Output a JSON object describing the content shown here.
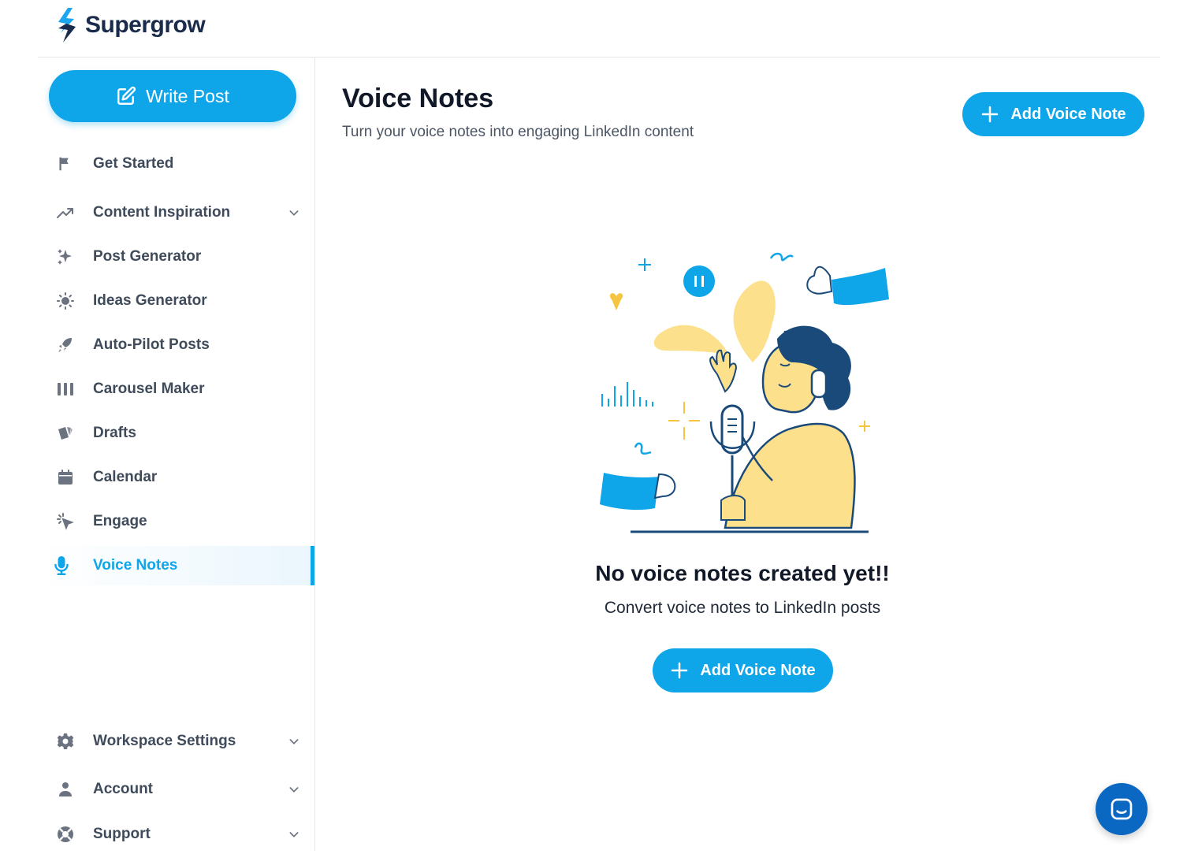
{
  "app": {
    "name": "Supergrow"
  },
  "sidebar": {
    "write_post_label": "Write Post",
    "items": [
      {
        "label": "Get Started",
        "icon": "flag-icon"
      },
      {
        "label": "Content Inspiration",
        "icon": "trending-up-icon",
        "expandable": true
      },
      {
        "label": "Post Generator",
        "icon": "sparkles-icon"
      },
      {
        "label": "Ideas Generator",
        "icon": "lightbulb-icon"
      },
      {
        "label": "Auto-Pilot Posts",
        "icon": "rocket-icon"
      },
      {
        "label": "Carousel Maker",
        "icon": "columns-icon"
      },
      {
        "label": "Drafts",
        "icon": "cards-icon"
      },
      {
        "label": "Calendar",
        "icon": "calendar-icon"
      },
      {
        "label": "Engage",
        "icon": "cursor-click-icon"
      },
      {
        "label": "Voice Notes",
        "icon": "microphone-icon",
        "active": true
      }
    ],
    "bottom_items": [
      {
        "label": "Workspace Settings",
        "icon": "gear-icon",
        "expandable": true
      },
      {
        "label": "Account",
        "icon": "user-icon",
        "expandable": true
      },
      {
        "label": "Support",
        "icon": "lifebuoy-icon",
        "expandable": true
      }
    ]
  },
  "main": {
    "title": "Voice Notes",
    "subtitle": "Turn your voice notes into engaging LinkedIn content",
    "add_button_label": "Add Voice Note",
    "empty_state": {
      "title": "No voice notes created yet!!",
      "subtitle": "Convert voice notes to LinkedIn posts",
      "button_label": "Add Voice Note"
    }
  },
  "colors": {
    "accent": "#0ea5e9",
    "brand_dark": "#1b2b4b",
    "illustration_yellow": "#fde08b",
    "illustration_navy": "#1a4a7a",
    "chat_blue": "#0a67c2"
  }
}
